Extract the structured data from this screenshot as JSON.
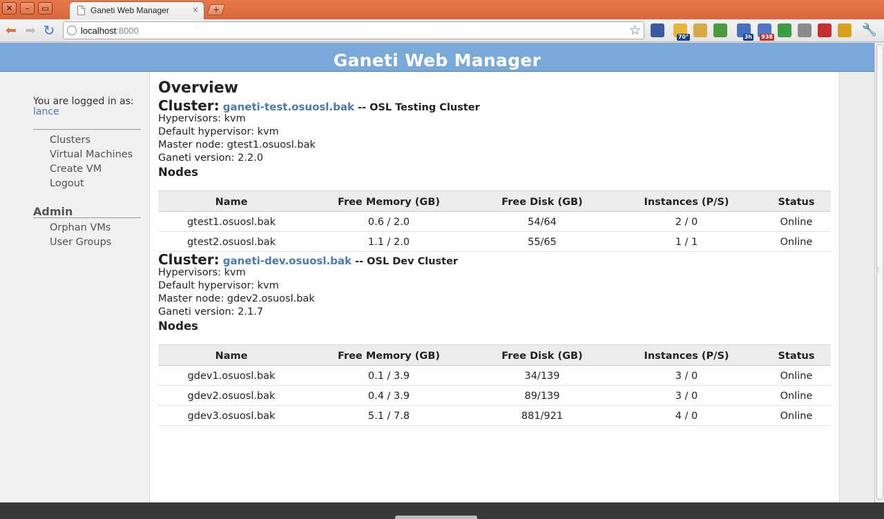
{
  "browser": {
    "window_buttons": [
      "✕",
      "–",
      "▭"
    ],
    "tab_title": "Ganeti Web Manager",
    "tab_close": "×",
    "newtab": "+",
    "url_host": "localhost",
    "url_port": ":8000",
    "extensions": [
      {
        "name": "gmail-icon",
        "color": "#3a5ba0",
        "badge": ""
      },
      {
        "name": "weather-icon",
        "color": "#e8b636",
        "badge": "70°",
        "badge_color": "#1c3f8a"
      },
      {
        "name": "notes-icon",
        "color": "#d9a84a",
        "badge": ""
      },
      {
        "name": "evernote-icon",
        "color": "#4c9a3f",
        "badge": ""
      },
      {
        "name": "calendar-icon",
        "color": "#4471c4",
        "badge": "3h",
        "badge_color": "#1c3f8a"
      },
      {
        "name": "rss-icon",
        "color": "#5276c6",
        "badge": "938",
        "badge_color": "#c23030"
      },
      {
        "name": "timer-icon",
        "color": "#3f9a44",
        "badge": ""
      },
      {
        "name": "tag-icon",
        "color": "#8a8a8a",
        "badge": ""
      },
      {
        "name": "rpt-icon",
        "color": "#c23030",
        "badge": ""
      },
      {
        "name": "remote-icon",
        "color": "#d9a020",
        "badge": ""
      }
    ]
  },
  "header": {
    "title": "Ganeti Web Manager"
  },
  "sidebar": {
    "logged_in_label": "You are logged in as:",
    "username": "lance",
    "nav": [
      "Clusters",
      "Virtual Machines",
      "Create VM",
      "Logout"
    ],
    "admin_heading": "Admin",
    "admin_nav": [
      "Orphan VMs",
      "User Groups"
    ]
  },
  "main": {
    "title": "Overview",
    "cluster_label": "Cluster:",
    "nodes_heading": "Nodes",
    "columns": [
      "Name",
      "Free Memory (GB)",
      "Free Disk (GB)",
      "Instances (P/S)",
      "Status"
    ],
    "clusters": [
      {
        "name": "ganeti-test.osuosl.bak",
        "description": "-- OSL Testing Cluster",
        "hypervisors": "Hypervisors: kvm",
        "default_hypervisor": "Default hypervisor: kvm",
        "master_node": "Master node: gtest1.osuosl.bak",
        "version": "Ganeti version: 2.2.0",
        "nodes": [
          [
            "gtest1.osuosl.bak",
            "0.6 / 2.0",
            "54/64",
            "2 / 0",
            "Online"
          ],
          [
            "gtest2.osuosl.bak",
            "1.1 / 2.0",
            "55/65",
            "1 / 1",
            "Online"
          ]
        ]
      },
      {
        "name": "ganeti-dev.osuosl.bak",
        "description": "-- OSL Dev Cluster",
        "hypervisors": "Hypervisors: kvm",
        "default_hypervisor": "Default hypervisor: kvm",
        "master_node": "Master node: gdev2.osuosl.bak",
        "version": "Ganeti version: 2.1.7",
        "nodes": [
          [
            "gdev1.osuosl.bak",
            "0.1 / 3.9",
            "34/139",
            "3 / 0",
            "Online"
          ],
          [
            "gdev2.osuosl.bak",
            "0.4 / 3.9",
            "89/139",
            "3 / 0",
            "Online"
          ],
          [
            "gdev3.osuosl.bak",
            "5.1 / 7.8",
            "881/921",
            "4 / 0",
            "Online"
          ]
        ]
      }
    ]
  },
  "colors": {
    "header_bg": "#7ba9d7",
    "link": "#4a78b5",
    "tabstrip": "#e06f42"
  }
}
